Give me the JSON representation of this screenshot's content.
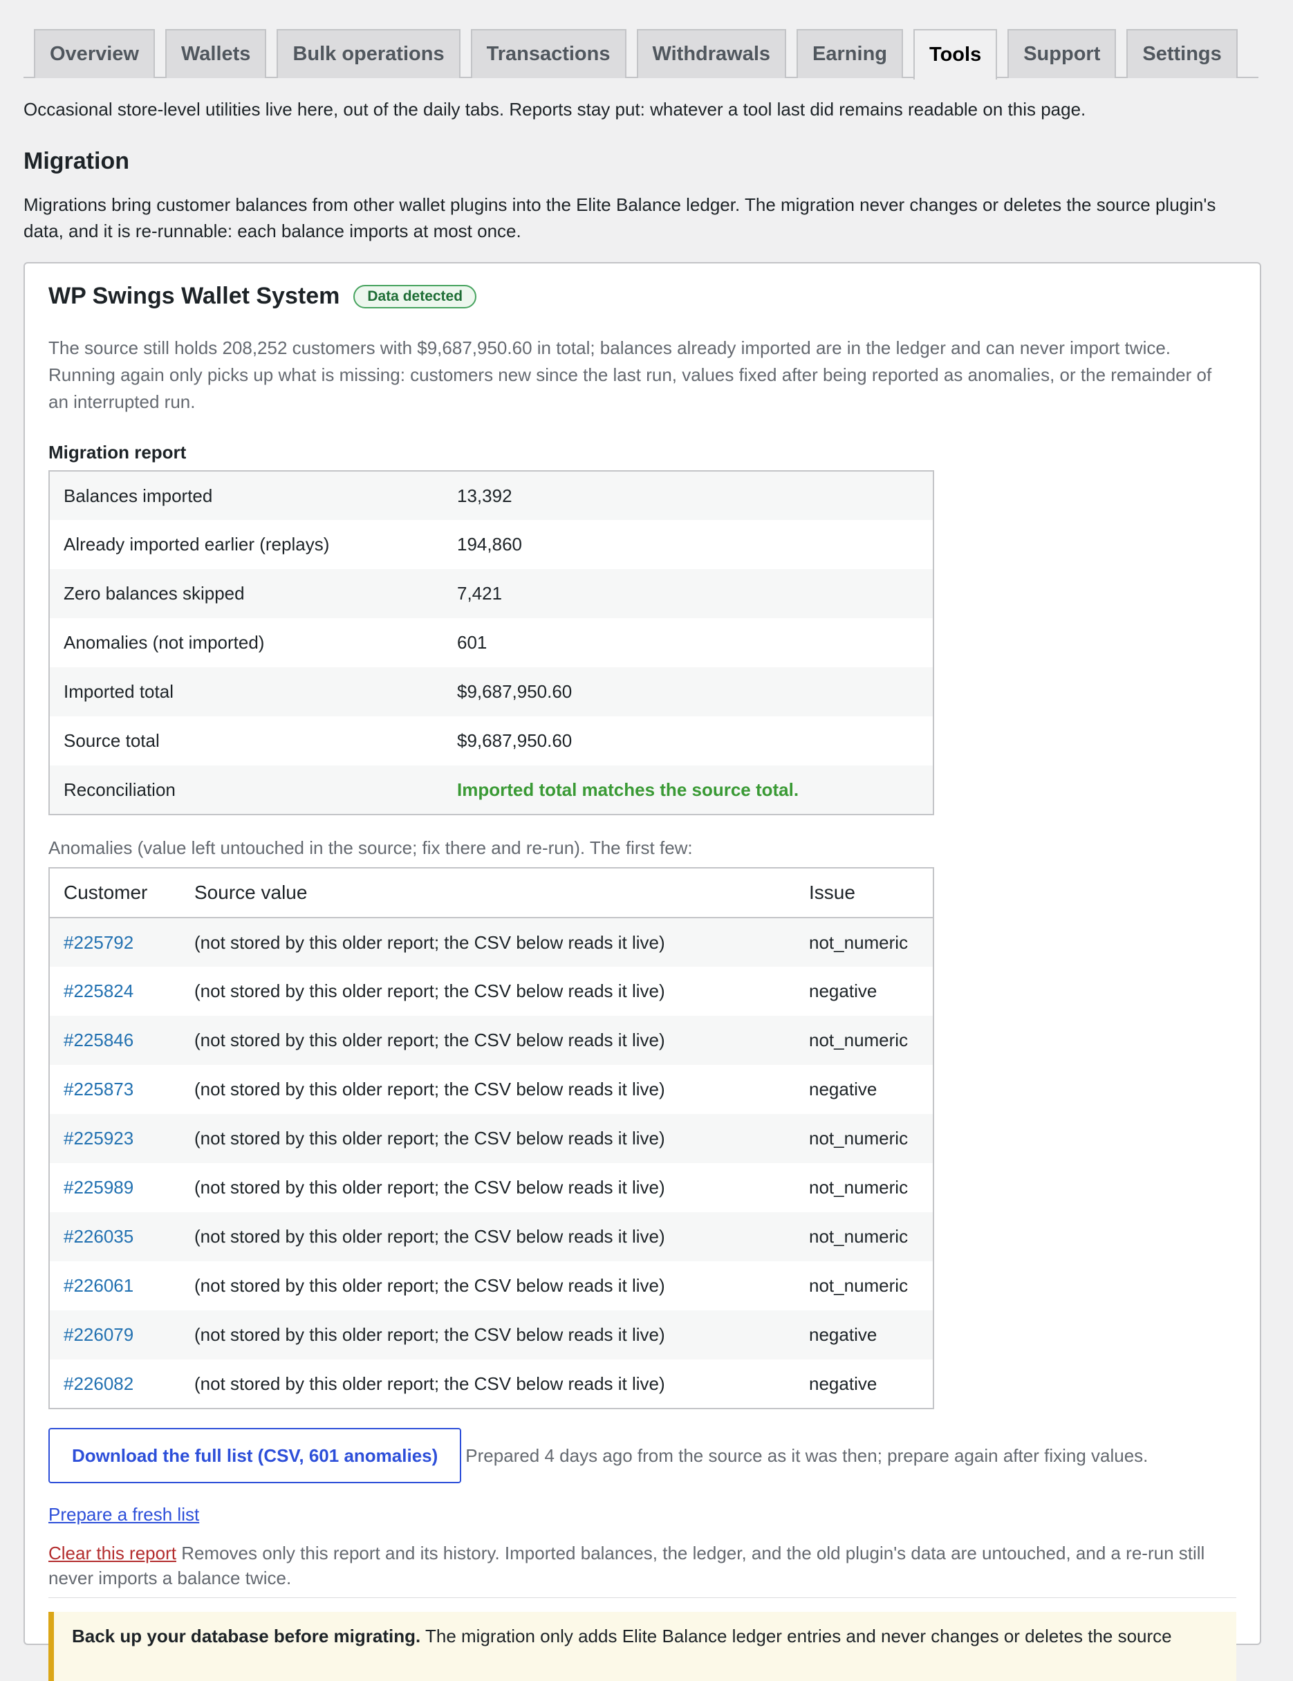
{
  "tabs": [
    {
      "label": "Overview",
      "active": false
    },
    {
      "label": "Wallets",
      "active": false
    },
    {
      "label": "Bulk operations",
      "active": false
    },
    {
      "label": "Transactions",
      "active": false
    },
    {
      "label": "Withdrawals",
      "active": false
    },
    {
      "label": "Earning",
      "active": false
    },
    {
      "label": "Tools",
      "active": true
    },
    {
      "label": "Support",
      "active": false
    },
    {
      "label": "Settings",
      "active": false
    }
  ],
  "intro": "Occasional store-level utilities live here, out of the daily tabs. Reports stay put: whatever a tool last did remains readable on this page.",
  "migration": {
    "heading": "Migration",
    "description": "Migrations bring customer balances from other wallet plugins into the Elite Balance ledger. The migration never changes or deletes the source plugin's data, and it is re-runnable: each balance imports at most once."
  },
  "card": {
    "title": "WP Swings Wallet System",
    "badge": "Data detected",
    "description": "The source still holds 208,252 customers with $9,687,950.60 in total; balances already imported are in the ledger and can never import twice. Running again only picks up what is missing: customers new since the last run, values fixed after being reported as anomalies, or the remainder of an interrupted run.",
    "report_label": "Migration report",
    "report": [
      {
        "key": "Balances imported",
        "value": "13,392"
      },
      {
        "key": "Already imported earlier (replays)",
        "value": "194,860"
      },
      {
        "key": "Zero balances skipped",
        "value": "7,421"
      },
      {
        "key": "Anomalies (not imported)",
        "value": "601"
      },
      {
        "key": "Imported total",
        "value": "$9,687,950.60"
      },
      {
        "key": "Source total",
        "value": "$9,687,950.60"
      },
      {
        "key": "Reconciliation",
        "value": "Imported total matches the source total."
      }
    ],
    "anomalies_note": "Anomalies (value left untouched in the source; fix there and re-run). The first few:",
    "anomalies_headers": [
      "Customer",
      "Source value",
      "Issue"
    ],
    "anomalies": [
      {
        "customer": "#225792",
        "source": "(not stored by this older report; the CSV below reads it live)",
        "issue": "not_numeric"
      },
      {
        "customer": "#225824",
        "source": "(not stored by this older report; the CSV below reads it live)",
        "issue": "negative"
      },
      {
        "customer": "#225846",
        "source": "(not stored by this older report; the CSV below reads it live)",
        "issue": "not_numeric"
      },
      {
        "customer": "#225873",
        "source": "(not stored by this older report; the CSV below reads it live)",
        "issue": "negative"
      },
      {
        "customer": "#225923",
        "source": "(not stored by this older report; the CSV below reads it live)",
        "issue": "not_numeric"
      },
      {
        "customer": "#225989",
        "source": "(not stored by this older report; the CSV below reads it live)",
        "issue": "not_numeric"
      },
      {
        "customer": "#226035",
        "source": "(not stored by this older report; the CSV below reads it live)",
        "issue": "not_numeric"
      },
      {
        "customer": "#226061",
        "source": "(not stored by this older report; the CSV below reads it live)",
        "issue": "not_numeric"
      },
      {
        "customer": "#226079",
        "source": "(not stored by this older report; the CSV below reads it live)",
        "issue": "negative"
      },
      {
        "customer": "#226082",
        "source": "(not stored by this older report; the CSV below reads it live)",
        "issue": "negative"
      }
    ],
    "download_label": "Download the full list (CSV, 601 anomalies)",
    "download_note": "Prepared 4 days ago from the source as it was then; prepare again after fixing values.",
    "fresh_label": "Prepare a fresh list",
    "clear_label": "Clear this report",
    "clear_note": " Removes only this report and its history. Imported balances, the ledger, and the old plugin's data are untouched, and a re-run still never imports a balance twice.",
    "warning_bold": "Back up your database before migrating.",
    "warning_text": " The migration only adds Elite Balance ledger entries and never changes or deletes the source"
  }
}
